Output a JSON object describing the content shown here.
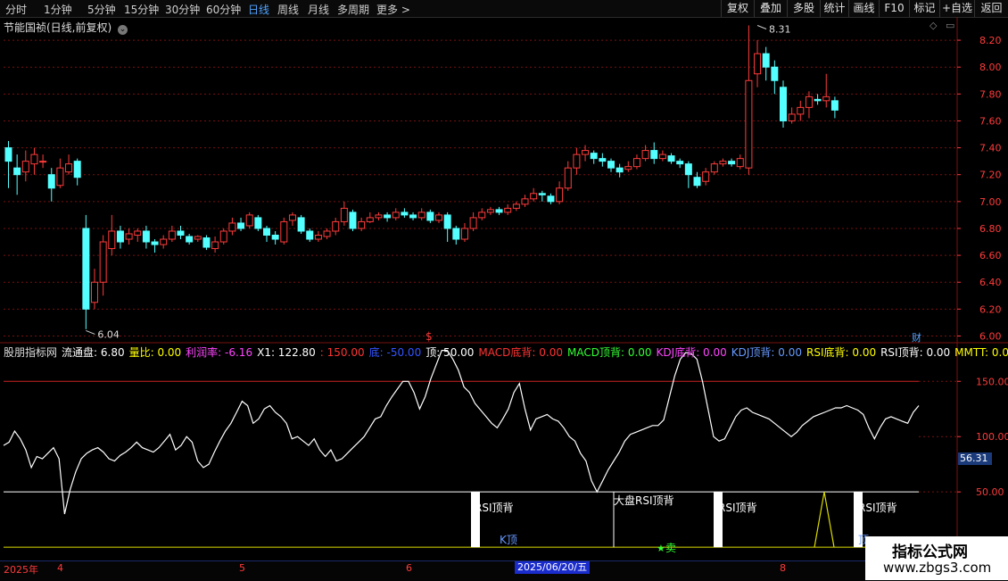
{
  "toolbar": {
    "timeframes": [
      "分时",
      "1分钟",
      "5分钟",
      "15分钟",
      "30分钟",
      "60分钟",
      "日线",
      "周线",
      "月线",
      "多周期",
      "更多 >"
    ],
    "active_timeframe": "日线",
    "buttons": [
      "复权",
      "叠加",
      "多股",
      "统计",
      "画线",
      "F10",
      "标记",
      "+自选",
      "返回"
    ]
  },
  "chart_title": "节能国祯(日线,前复权)",
  "price_axis": [
    "8.20",
    "8.00",
    "7.80",
    "7.60",
    "7.40",
    "7.20",
    "7.00",
    "6.80",
    "6.60",
    "6.40",
    "6.20",
    "6.00"
  ],
  "annotations": {
    "high": "8.31",
    "low": "6.04",
    "cai": "财",
    "dollar": "$"
  },
  "indicator": {
    "name": "股朋指标网",
    "items": [
      {
        "label": "流通盘:",
        "value": "6.80",
        "color": "#ffffff"
      },
      {
        "label": "量比:",
        "value": "0.00",
        "color": "#ffff00"
      },
      {
        "label": "利润率:",
        "value": "-6.16",
        "color": "#ff44ff"
      },
      {
        "label": "X1:",
        "value": "122.80",
        "color": "#ffffff"
      },
      {
        "label": ":",
        "value": "150.00",
        "color": "#ff3333"
      },
      {
        "label": "底:",
        "value": "-50.00",
        "color": "#3355ff"
      },
      {
        "label": "顶:",
        "value": "50.00",
        "color": "#ffffff"
      },
      {
        "label": "MACD底背:",
        "value": "0.00",
        "color": "#ff3333"
      },
      {
        "label": "MACD顶背:",
        "value": "0.00",
        "color": "#33ff33"
      },
      {
        "label": "KDJ底背:",
        "value": "0.00",
        "color": "#ff44ff"
      },
      {
        "label": "KDJ顶背:",
        "value": "0.00",
        "color": "#6699ff"
      },
      {
        "label": "RSI底背:",
        "value": "0.00",
        "color": "#ffff00"
      },
      {
        "label": "RSI顶背:",
        "value": "0.00",
        "color": "#ffffff"
      },
      {
        "label": "MMTT:",
        "value": "0.0",
        "color": "#ffff00"
      }
    ],
    "axis": [
      "150.00",
      "100.00",
      "50.00",
      "0.00"
    ],
    "current_value": "56.31",
    "marks": [
      "RSI顶背",
      "K顶",
      "大盘RSI顶背",
      "卖",
      "RSI顶背",
      "RSI顶背",
      "顶"
    ]
  },
  "dates": [
    "2025年",
    "4",
    "5",
    "6",
    "8"
  ],
  "selected_date": "2025/06/20/五",
  "watermark": {
    "title": "指标公式网",
    "url": "www.zbgs3.com"
  },
  "colors": {
    "up": "#ff3b3b",
    "down": "#54ffff",
    "grid": "#7a1010"
  },
  "chart_data": {
    "type": "candlestick",
    "title": "节能国祯(日线,前复权)",
    "y_range": [
      5.95,
      8.3
    ],
    "candles": [
      [
        7.4,
        7.3,
        7.45,
        7.1
      ],
      [
        7.25,
        7.2,
        7.35,
        7.05
      ],
      [
        7.22,
        7.3,
        7.38,
        7.15
      ],
      [
        7.28,
        7.35,
        7.4,
        7.2
      ],
      [
        7.3,
        7.3,
        7.35,
        7.25
      ],
      [
        7.2,
        7.1,
        7.25,
        7.0
      ],
      [
        7.12,
        7.25,
        7.32,
        7.1
      ],
      [
        7.22,
        7.28,
        7.35,
        7.2
      ],
      [
        7.3,
        7.18,
        7.32,
        7.12
      ],
      [
        6.8,
        6.2,
        6.9,
        6.05
      ],
      [
        6.25,
        6.4,
        6.5,
        6.2
      ],
      [
        6.4,
        6.7,
        6.75,
        6.3
      ],
      [
        6.65,
        6.78,
        6.9,
        6.6
      ],
      [
        6.78,
        6.7,
        6.82,
        6.65
      ],
      [
        6.72,
        6.76,
        6.8,
        6.68
      ],
      [
        6.75,
        6.78,
        6.8,
        6.7
      ],
      [
        6.78,
        6.7,
        6.82,
        6.65
      ],
      [
        6.7,
        6.68,
        6.72,
        6.62
      ],
      [
        6.68,
        6.72,
        6.75,
        6.65
      ],
      [
        6.72,
        6.78,
        6.82,
        6.7
      ],
      [
        6.78,
        6.75,
        6.82,
        6.72
      ],
      [
        6.74,
        6.7,
        6.76,
        6.68
      ],
      [
        6.72,
        6.74,
        6.75,
        6.7
      ],
      [
        6.73,
        6.66,
        6.75,
        6.64
      ],
      [
        6.65,
        6.7,
        6.74,
        6.62
      ],
      [
        6.7,
        6.78,
        6.8,
        6.68
      ],
      [
        6.78,
        6.84,
        6.88,
        6.75
      ],
      [
        6.84,
        6.8,
        6.88,
        6.78
      ],
      [
        6.82,
        6.9,
        6.92,
        6.8
      ],
      [
        6.88,
        6.8,
        6.9,
        6.78
      ],
      [
        6.8,
        6.75,
        6.82,
        6.7
      ],
      [
        6.75,
        6.72,
        6.78,
        6.68
      ],
      [
        6.7,
        6.85,
        6.88,
        6.68
      ],
      [
        6.86,
        6.9,
        6.92,
        6.82
      ],
      [
        6.88,
        6.78,
        6.9,
        6.76
      ],
      [
        6.78,
        6.72,
        6.8,
        6.7
      ],
      [
        6.72,
        6.75,
        6.78,
        6.7
      ],
      [
        6.74,
        6.78,
        6.8,
        6.72
      ],
      [
        6.78,
        6.85,
        6.88,
        6.75
      ],
      [
        6.85,
        6.95,
        7.0,
        6.82
      ],
      [
        6.92,
        6.8,
        6.94,
        6.78
      ],
      [
        6.8,
        6.85,
        6.88,
        6.78
      ],
      [
        6.85,
        6.88,
        6.92,
        6.84
      ],
      [
        6.88,
        6.9,
        6.92,
        6.86
      ],
      [
        6.9,
        6.88,
        6.92,
        6.85
      ],
      [
        6.88,
        6.92,
        6.95,
        6.86
      ],
      [
        6.92,
        6.9,
        6.95,
        6.88
      ],
      [
        6.9,
        6.88,
        6.92,
        6.86
      ],
      [
        6.88,
        6.92,
        6.95,
        6.86
      ],
      [
        6.92,
        6.86,
        6.94,
        6.84
      ],
      [
        6.86,
        6.9,
        6.92,
        6.84
      ],
      [
        6.9,
        6.8,
        6.92,
        6.7
      ],
      [
        6.8,
        6.72,
        6.82,
        6.68
      ],
      [
        6.72,
        6.8,
        6.84,
        6.7
      ],
      [
        6.8,
        6.88,
        6.92,
        6.78
      ],
      [
        6.88,
        6.92,
        6.95,
        6.86
      ],
      [
        6.92,
        6.94,
        6.96,
        6.9
      ],
      [
        6.94,
        6.92,
        6.96,
        6.9
      ],
      [
        6.92,
        6.95,
        6.98,
        6.9
      ],
      [
        6.95,
        6.98,
        7.0,
        6.93
      ],
      [
        6.98,
        7.02,
        7.05,
        6.96
      ],
      [
        7.02,
        7.06,
        7.1,
        7.0
      ],
      [
        7.06,
        7.05,
        7.08,
        7.0
      ],
      [
        7.04,
        7.0,
        7.06,
        6.98
      ],
      [
        7.0,
        7.1,
        7.15,
        6.98
      ],
      [
        7.1,
        7.25,
        7.3,
        7.08
      ],
      [
        7.25,
        7.35,
        7.4,
        7.2
      ],
      [
        7.35,
        7.38,
        7.42,
        7.3
      ],
      [
        7.36,
        7.32,
        7.38,
        7.28
      ],
      [
        7.32,
        7.3,
        7.36,
        7.26
      ],
      [
        7.3,
        7.25,
        7.32,
        7.22
      ],
      [
        7.25,
        7.22,
        7.28,
        7.18
      ],
      [
        7.24,
        7.26,
        7.3,
        7.22
      ],
      [
        7.26,
        7.32,
        7.35,
        7.24
      ],
      [
        7.32,
        7.38,
        7.42,
        7.3
      ],
      [
        7.38,
        7.32,
        7.44,
        7.28
      ],
      [
        7.32,
        7.35,
        7.38,
        7.3
      ],
      [
        7.34,
        7.3,
        7.36,
        7.28
      ],
      [
        7.3,
        7.28,
        7.32,
        7.25
      ],
      [
        7.28,
        7.2,
        7.3,
        7.1
      ],
      [
        7.18,
        7.12,
        7.22,
        7.1
      ],
      [
        7.15,
        7.22,
        7.25,
        7.12
      ],
      [
        7.22,
        7.28,
        7.3,
        7.2
      ],
      [
        7.28,
        7.3,
        7.32,
        7.26
      ],
      [
        7.3,
        7.28,
        7.32,
        7.26
      ],
      [
        7.26,
        7.32,
        7.35,
        7.24
      ],
      [
        7.25,
        7.9,
        8.31,
        7.2
      ],
      [
        7.95,
        8.1,
        8.2,
        7.85
      ],
      [
        8.1,
        8.0,
        8.15,
        7.9
      ],
      [
        8.0,
        7.9,
        8.05,
        7.8
      ],
      [
        7.85,
        7.6,
        7.9,
        7.55
      ],
      [
        7.6,
        7.65,
        7.7,
        7.58
      ],
      [
        7.65,
        7.7,
        7.75,
        7.6
      ],
      [
        7.7,
        7.78,
        7.82,
        7.62
      ],
      [
        7.76,
        7.75,
        7.8,
        7.72
      ],
      [
        7.75,
        7.78,
        7.95,
        7.7
      ],
      [
        7.75,
        7.68,
        7.78,
        7.62
      ]
    ],
    "ind_range": [
      -12,
      172
    ],
    "ind_line": [
      92,
      95,
      105,
      98,
      88,
      72,
      82,
      80,
      85,
      90,
      80,
      30,
      52,
      68,
      80,
      85,
      88,
      90,
      86,
      80,
      78,
      83,
      86,
      90,
      95,
      90,
      88,
      86,
      90,
      96,
      102,
      88,
      92,
      100,
      95,
      78,
      72,
      75,
      86,
      96,
      105,
      112,
      122,
      132,
      128,
      112,
      116,
      125,
      128,
      122,
      118,
      112,
      98,
      100,
      96,
      92,
      98,
      88,
      82,
      88,
      78,
      80,
      85,
      90,
      95,
      100,
      108,
      116,
      118,
      128,
      136,
      143,
      150,
      150,
      140,
      125,
      136,
      152,
      165,
      178,
      178,
      170,
      160,
      145,
      140,
      130,
      124,
      118,
      112,
      108,
      116,
      125,
      140,
      148,
      125,
      106,
      116,
      118,
      120,
      116,
      114,
      108,
      100,
      96,
      85,
      78,
      60,
      50,
      60,
      70,
      78,
      86,
      96,
      102,
      104,
      106,
      108,
      110,
      110,
      115,
      135,
      155,
      170,
      176,
      175,
      170,
      150,
      125,
      100,
      96,
      98,
      108,
      118,
      124,
      126,
      122,
      120,
      118,
      116,
      112,
      108,
      104,
      100,
      104,
      110,
      114,
      118,
      120,
      122,
      124,
      126,
      126,
      128,
      126,
      124,
      120,
      108,
      98,
      108,
      116,
      118,
      116,
      114,
      112,
      122,
      128
    ]
  }
}
